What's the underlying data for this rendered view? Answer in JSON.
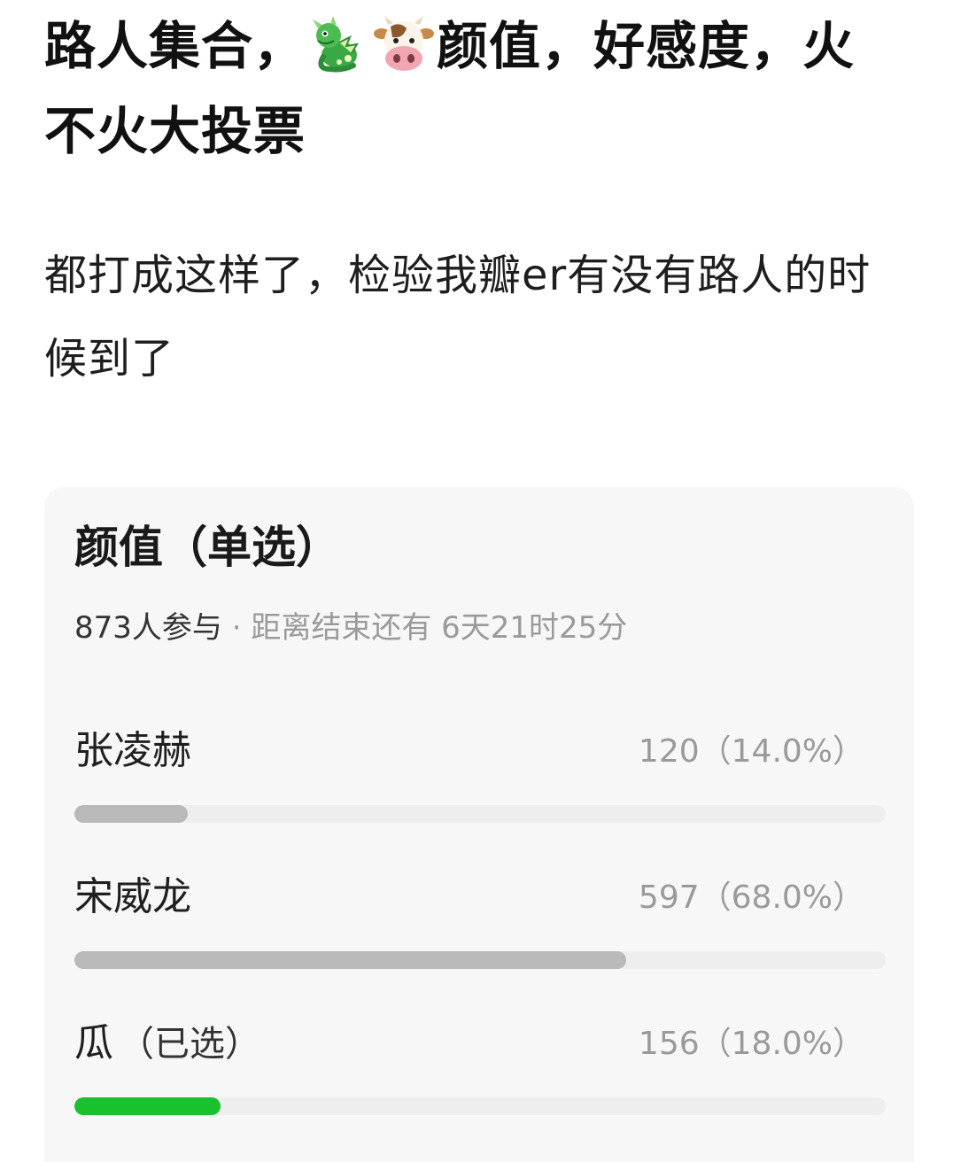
{
  "post": {
    "title_part1": "路人集合，",
    "title_emojis": [
      "dragon-emoji",
      "cow-face-emoji"
    ],
    "title_part2": "颜值，好感度，火不火大投票",
    "body": "都打成这样了，检验我瓣er有没有路人的时候到了"
  },
  "poll": {
    "title": "颜值（单选）",
    "participants": "873人参与",
    "separator": " · ",
    "time_remaining": "距离结束还有 6天21时25分",
    "options": [
      {
        "name": "张凌赫",
        "selected_tag": "",
        "result": "120（14.0%）",
        "percent": 14.0,
        "selected": false
      },
      {
        "name": "宋威龙",
        "selected_tag": "",
        "result": "597（68.0%）",
        "percent": 68.0,
        "selected": false
      },
      {
        "name": "瓜",
        "selected_tag": "（已选）",
        "result": "156（18.0%）",
        "percent": 18.0,
        "selected": true
      }
    ]
  },
  "colors": {
    "bar_default": "#b9b9b9",
    "bar_selected": "#19c12e",
    "card_background": "#f7f7f7"
  }
}
